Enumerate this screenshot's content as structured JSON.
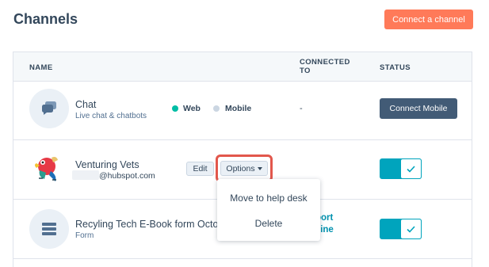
{
  "page": {
    "title": "Channels",
    "connect_channel_label": "Connect a channel"
  },
  "table": {
    "headers": {
      "name": "NAME",
      "connected_to": "CONNECTED TO",
      "status": "STATUS"
    }
  },
  "rows": [
    {
      "title": "Chat",
      "subtitle": "Live chat & chatbots",
      "options": [
        "Web",
        "Mobile"
      ],
      "selected_option": "Web",
      "connected_to": "-",
      "action_label": "Connect Mobile"
    },
    {
      "title": "Venturing Vets",
      "subtitle": "@hubspot.com",
      "edit_label": "Edit",
      "options_label": "Options",
      "status_on": true
    },
    {
      "title": "Recyling Tech E-Book form Octob",
      "subtitle": "Form",
      "connected_partial_1": "port",
      "connected_partial_2": "line",
      "status_on": true
    }
  ],
  "dropdown": {
    "items": [
      "Move to help desk",
      "Delete"
    ]
  },
  "colors": {
    "accent": "#ff7a59",
    "primary_dark": "#425b76",
    "toggle_on": "#00a4bd",
    "highlight": "#e2574c",
    "link": "#0091ae"
  }
}
